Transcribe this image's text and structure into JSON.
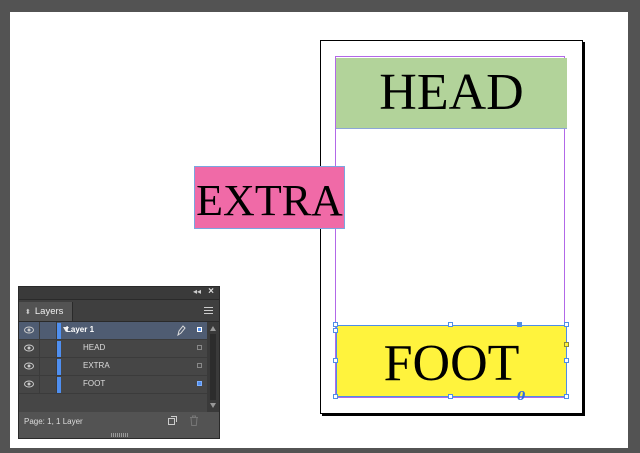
{
  "document": {
    "frames": {
      "head": "HEAD",
      "extra": "EXTRA",
      "foot": "FOOT"
    },
    "colors": {
      "head_fill": "#b2d39a",
      "extra_fill": "#f06aa7",
      "foot_fill": "#fff33d",
      "selection": "#4e8ee8",
      "margin_guide": "#b268e8"
    }
  },
  "layers_panel": {
    "tab_label": "Layers",
    "layers": [
      {
        "name": "Layer 1",
        "type": "layer",
        "selected": true
      },
      {
        "name": "HEAD",
        "type": "item",
        "selected": false
      },
      {
        "name": "EXTRA",
        "type": "item",
        "selected": false
      },
      {
        "name": "FOOT",
        "type": "item",
        "selected": true
      }
    ],
    "footer_status": "Page: 1, 1 Layer"
  }
}
